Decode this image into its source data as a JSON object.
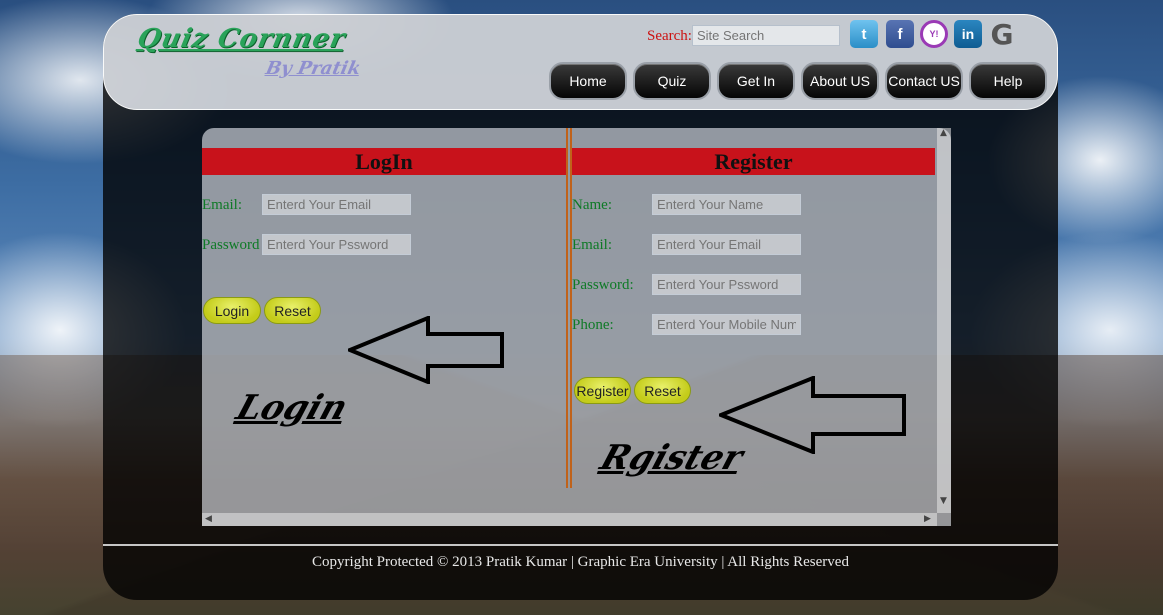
{
  "header": {
    "logo_title": "Quiz Cornner",
    "logo_sub": "By Pratik",
    "search_label": "Search:",
    "search_placeholder": "Site Search",
    "social": [
      "twitter-icon",
      "facebook-icon",
      "yahoo-icon",
      "linkedin-icon",
      "google-icon"
    ],
    "nav": [
      "Home",
      "Quiz",
      "Get In",
      "About US",
      "Contact US",
      "Help"
    ]
  },
  "login": {
    "title": "LogIn",
    "email_label": "Email:",
    "email_placeholder": "Enterd Your Email",
    "password_label": "Password",
    "password_placeholder": "Enterd Your Pssword",
    "login_button": "Login",
    "reset_button": "Reset",
    "annotation": "Login"
  },
  "register": {
    "title": "Register",
    "name_label": "Name:",
    "name_placeholder": "Enterd Your Name",
    "email_label": "Email:",
    "email_placeholder": "Enterd Your Email",
    "password_label": "Password:",
    "password_placeholder": "Enterd Your Pssword",
    "phone_label": "Phone:",
    "phone_placeholder": "Enterd Your Mobile Num",
    "register_button": "Register",
    "reset_button": "Reset",
    "annotation": "Rgister"
  },
  "footer": {
    "text": "Copyright Protected © 2013 Pratik Kumar | Graphic Era University | All Rights Reserved"
  },
  "colors": {
    "panel_header": "#c8121b",
    "label_green": "#0e7a26",
    "button_yellow": "#c4cc1a",
    "search_red": "#cc1111"
  }
}
